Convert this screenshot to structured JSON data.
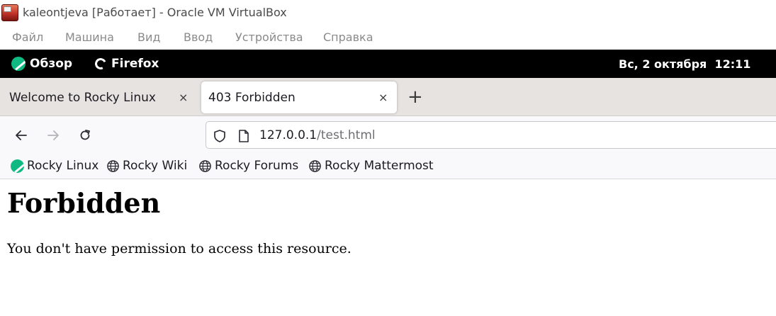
{
  "window": {
    "title": "kaleontjeva [Работает] - Oracle VM VirtualBox",
    "app_icon": "virtualbox-icon"
  },
  "menubar": {
    "items": [
      "Файл",
      "Машина",
      "Вид",
      "Ввод",
      "Устройства",
      "Справка"
    ]
  },
  "gnome_bar": {
    "activities_label": "Обзор",
    "app_label": "Firefox",
    "clock": "Вс, 2 октября  12:11"
  },
  "browser": {
    "tabs": [
      {
        "title": "Welcome to Rocky Linux",
        "active": false
      },
      {
        "title": "403 Forbidden",
        "active": true
      }
    ],
    "new_tab_symbol": "+",
    "close_symbol": "×",
    "url": {
      "host": "127.0.0.1",
      "path": "/test.html"
    },
    "bookmarks": [
      {
        "label": "Rocky Linux",
        "icon": "rocky-logo-icon"
      },
      {
        "label": "Rocky Wiki",
        "icon": "globe-icon"
      },
      {
        "label": "Rocky Forums",
        "icon": "globe-icon"
      },
      {
        "label": "Rocky Mattermost",
        "icon": "globe-icon"
      }
    ]
  },
  "page": {
    "heading": "Forbidden",
    "message": "You don't have permission to access this resource."
  },
  "colors": {
    "rocky_green": "#10b981",
    "gnome_bar": "#000000",
    "tabstrip": "#e6e3e1",
    "toolbar": "#f9f9fb"
  }
}
